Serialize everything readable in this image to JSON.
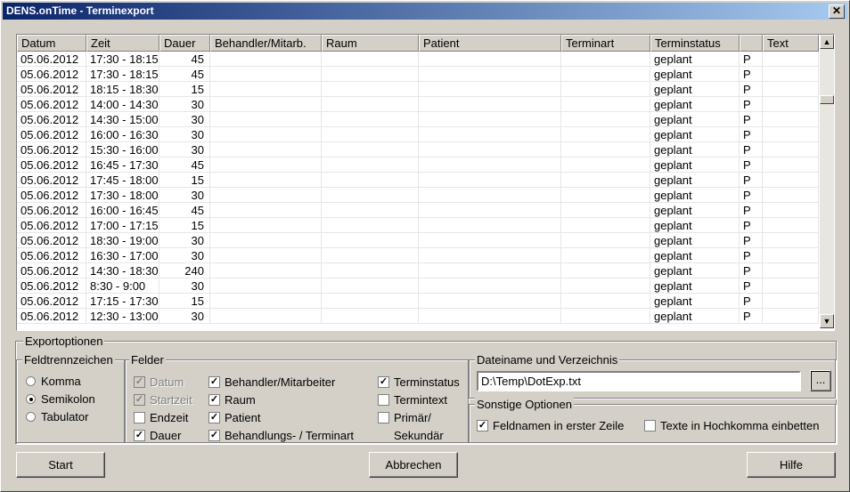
{
  "window": {
    "title": "DENS.onTime - Terminexport",
    "close_glyph": "✕"
  },
  "grid": {
    "columns": [
      "Datum",
      "Zeit",
      "Dauer",
      "Behandler/Mitarb.",
      "Raum",
      "Patient",
      "Terminart",
      "Terminstatus",
      "",
      "Text"
    ],
    "rows": [
      [
        "05.06.2012",
        "17:30 - 18:15",
        "45",
        "",
        "",
        "",
        "",
        "geplant",
        "P",
        ""
      ],
      [
        "05.06.2012",
        "17:30 - 18:15",
        "45",
        "",
        "",
        "",
        "",
        "geplant",
        "P",
        ""
      ],
      [
        "05.06.2012",
        "18:15 - 18:30",
        "15",
        "",
        "",
        "",
        "",
        "geplant",
        "P",
        ""
      ],
      [
        "05.06.2012",
        "14:00 - 14:30",
        "30",
        "",
        "",
        "",
        "",
        "geplant",
        "P",
        ""
      ],
      [
        "05.06.2012",
        "14:30 - 15:00",
        "30",
        "",
        "",
        "",
        "",
        "geplant",
        "P",
        ""
      ],
      [
        "05.06.2012",
        "16:00 - 16:30",
        "30",
        "",
        "",
        "",
        "",
        "geplant",
        "P",
        ""
      ],
      [
        "05.06.2012",
        "15:30 - 16:00",
        "30",
        "",
        "",
        "",
        "",
        "geplant",
        "P",
        ""
      ],
      [
        "05.06.2012",
        "16:45 - 17:30",
        "45",
        "",
        "",
        "",
        "",
        "geplant",
        "P",
        ""
      ],
      [
        "05.06.2012",
        "17:45 - 18:00",
        "15",
        "",
        "",
        "",
        "",
        "geplant",
        "P",
        ""
      ],
      [
        "05.06.2012",
        "17:30 - 18:00",
        "30",
        "",
        "",
        "",
        "",
        "geplant",
        "P",
        ""
      ],
      [
        "05.06.2012",
        "16:00 - 16:45",
        "45",
        "",
        "",
        "",
        "",
        "geplant",
        "P",
        ""
      ],
      [
        "05.06.2012",
        "17:00 - 17:15",
        "15",
        "",
        "",
        "",
        "",
        "geplant",
        "P",
        ""
      ],
      [
        "05.06.2012",
        "18:30 - 19:00",
        "30",
        "",
        "",
        "",
        "",
        "geplant",
        "P",
        ""
      ],
      [
        "05.06.2012",
        "16:30 - 17:00",
        "30",
        "",
        "",
        "",
        "",
        "geplant",
        "P",
        ""
      ],
      [
        "05.06.2012",
        "14:30 - 18:30",
        "240",
        "",
        "",
        "",
        "",
        "geplant",
        "P",
        ""
      ],
      [
        "05.06.2012",
        "8:30 - 9:00",
        "30",
        "",
        "",
        "",
        "",
        "geplant",
        "P",
        ""
      ],
      [
        "05.06.2012",
        "17:15 - 17:30",
        "15",
        "",
        "",
        "",
        "",
        "geplant",
        "P",
        ""
      ],
      [
        "05.06.2012",
        "12:30 - 13:00",
        "30",
        "",
        "",
        "",
        "",
        "geplant",
        "P",
        ""
      ]
    ]
  },
  "export": {
    "title": "Exportoptionen",
    "separator": {
      "title": "Feldtrennzeichen",
      "options": [
        "Komma",
        "Semikolon",
        "Tabulator"
      ],
      "selected": "Semikolon"
    },
    "fields": {
      "title": "Felder",
      "items": [
        {
          "label": "Datum",
          "checked": true,
          "disabled": true
        },
        {
          "label": "Startzeit",
          "checked": true,
          "disabled": true
        },
        {
          "label": "Endzeit",
          "checked": false,
          "disabled": false
        },
        {
          "label": "Dauer",
          "checked": true,
          "disabled": false
        },
        {
          "label": "Behandler/Mitarbeiter",
          "checked": true,
          "disabled": false
        },
        {
          "label": "Raum",
          "checked": true,
          "disabled": false
        },
        {
          "label": "Patient",
          "checked": true,
          "disabled": false
        },
        {
          "label": "Behandlungs- / Terminart",
          "checked": true,
          "disabled": false
        },
        {
          "label": "Terminstatus",
          "checked": true,
          "disabled": false
        },
        {
          "label": "Termintext",
          "checked": false,
          "disabled": false
        },
        {
          "label": "Primär/",
          "label2": "Sekundär",
          "checked": false,
          "disabled": false
        }
      ]
    },
    "file": {
      "title": "Dateiname und Verzeichnis",
      "value": "D:\\Temp\\DotExp.txt",
      "browse_label": "..."
    },
    "other": {
      "title": "Sonstige Optionen",
      "header_row": {
        "label": "Feldnamen in erster Zeile",
        "checked": true
      },
      "quote": {
        "label": "Texte in Hochkomma einbetten",
        "checked": false
      }
    }
  },
  "buttons": {
    "start": "Start",
    "cancel": "Abbrechen",
    "help": "Hilfe"
  },
  "colors": {
    "face": "#d4d0c8",
    "title_start": "#0a246a",
    "title_end": "#a6caf0"
  }
}
